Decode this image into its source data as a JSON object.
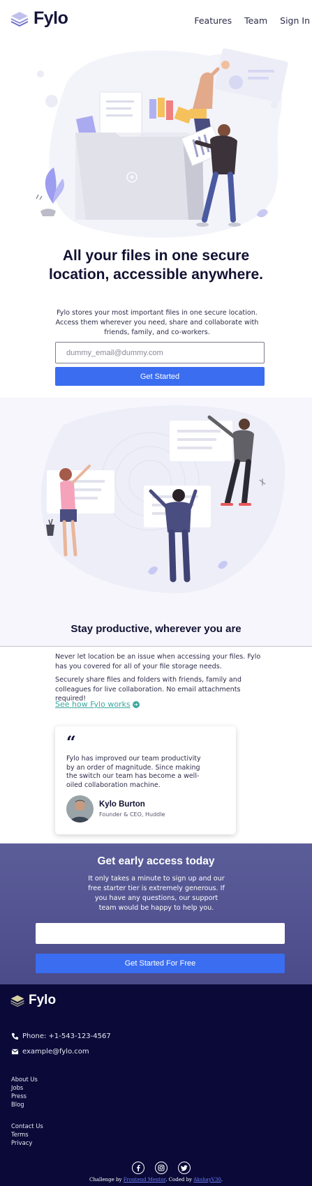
{
  "header": {
    "brand": "Fylo",
    "nav": [
      "Features",
      "Team",
      "Sign In"
    ]
  },
  "hero": {
    "title": "All your files in one secure location, accessible anywhere.",
    "description": "Fylo stores your most important files in one secure location. Access them wherever you need, share and collaborate with friends, family, and co-workers.",
    "email_placeholder": "dummy_email@dummy.com",
    "cta": "Get Started"
  },
  "productive": {
    "title": "Stay productive, wherever you are",
    "p1": "Never let location be an issue when accessing your files. Fylo has you covered for all of your file storage needs.",
    "p2": "Securely share files and folders with friends, family and colleagues for live collaboration. No email attachments required!",
    "link": "See how Fylo works"
  },
  "testimonial": {
    "quote": "Fylo has improved our team productivity by an order of magnitude. Since making the switch our team has become a well-oiled collaboration machine.",
    "name": "Kylo Burton",
    "role": "Founder & CEO, Huddle"
  },
  "early_access": {
    "title": "Get early access today",
    "description": "It only takes a minute to sign up and our free starter tier is extremely generous. If you have any questions, our support team would be happy to help you.",
    "email_value": "",
    "cta": "Get Started For Free"
  },
  "footer": {
    "brand": "Fylo",
    "phone": "Phone: +1-543-123-4567",
    "email": "example@fylo.com",
    "links_1": [
      "About Us",
      "Jobs",
      "Press",
      "Blog"
    ],
    "links_2": [
      "Contact Us",
      "Terms",
      "Privacy"
    ],
    "attribution": {
      "prefix": "Challenge by ",
      "fm": "Frontend Mentor",
      "middle": ". Coded by ",
      "author": "AkshayV30",
      "suffix": "."
    }
  },
  "colors": {
    "primary_blue": "#3a6df0",
    "footer_bg": "#0a0938",
    "early_bg": "#5b5d99",
    "link_teal": "#3ba8a0"
  }
}
